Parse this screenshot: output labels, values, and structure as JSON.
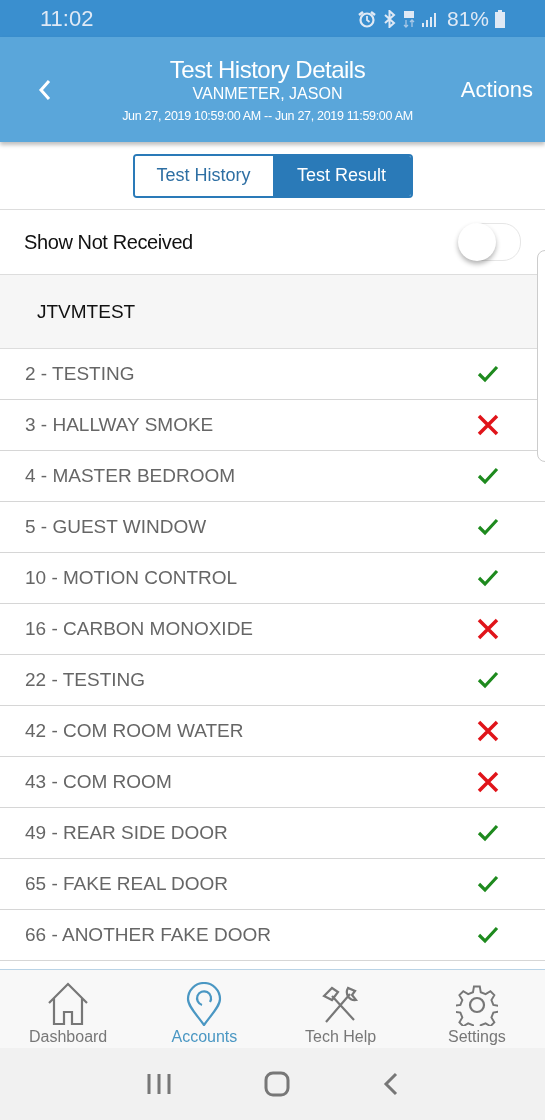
{
  "status_bar": {
    "time": "11:02",
    "battery": "81%"
  },
  "header": {
    "title": "Test History Details",
    "subtitle": "VANMETER, JASON",
    "range": "Jun 27, 2019 10:59:00 AM -- Jun 27, 2019 11:59:00 AM",
    "action": "Actions"
  },
  "tabs": [
    {
      "label": "Test History",
      "selected": false
    },
    {
      "label": "Test Result",
      "selected": true
    }
  ],
  "toggle": {
    "label": "Show Not Received",
    "on": false
  },
  "group": {
    "title": "JTVMTEST"
  },
  "zones": [
    {
      "name": "2 - TESTING",
      "received": true
    },
    {
      "name": "3 - HALLWAY SMOKE",
      "received": false
    },
    {
      "name": "4 - MASTER BEDROOM",
      "received": true
    },
    {
      "name": "5 - GUEST WINDOW",
      "received": true
    },
    {
      "name": "10 - MOTION CONTROL",
      "received": true
    },
    {
      "name": "16 - CARBON MONOXIDE",
      "received": false
    },
    {
      "name": "22 - TESTING",
      "received": true
    },
    {
      "name": "42 - COM ROOM WATER",
      "received": false
    },
    {
      "name": "43 - COM ROOM",
      "received": false
    },
    {
      "name": "49 - REAR SIDE DOOR",
      "received": true
    },
    {
      "name": "65 - FAKE REAL DOOR",
      "received": true
    },
    {
      "name": "66 - ANOTHER FAKE DOOR",
      "received": true
    }
  ],
  "nav": [
    {
      "label": "Dashboard",
      "kind": "home",
      "selected": false
    },
    {
      "label": "Accounts",
      "kind": "pin",
      "selected": true
    },
    {
      "label": "Tech Help",
      "kind": "tools",
      "selected": false
    },
    {
      "label": "Settings",
      "kind": "gear",
      "selected": false
    }
  ]
}
